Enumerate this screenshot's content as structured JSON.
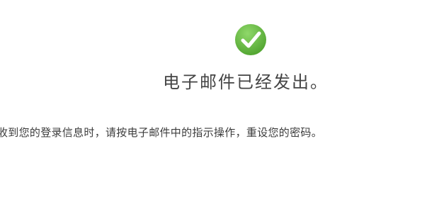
{
  "status": {
    "icon": "check-circle-icon",
    "icon_color": "#6cc04a",
    "title": "电子邮件已经发出。",
    "message": "收到您的登录信息时，请按电子邮件中的指示操作，重设您的密码。"
  }
}
